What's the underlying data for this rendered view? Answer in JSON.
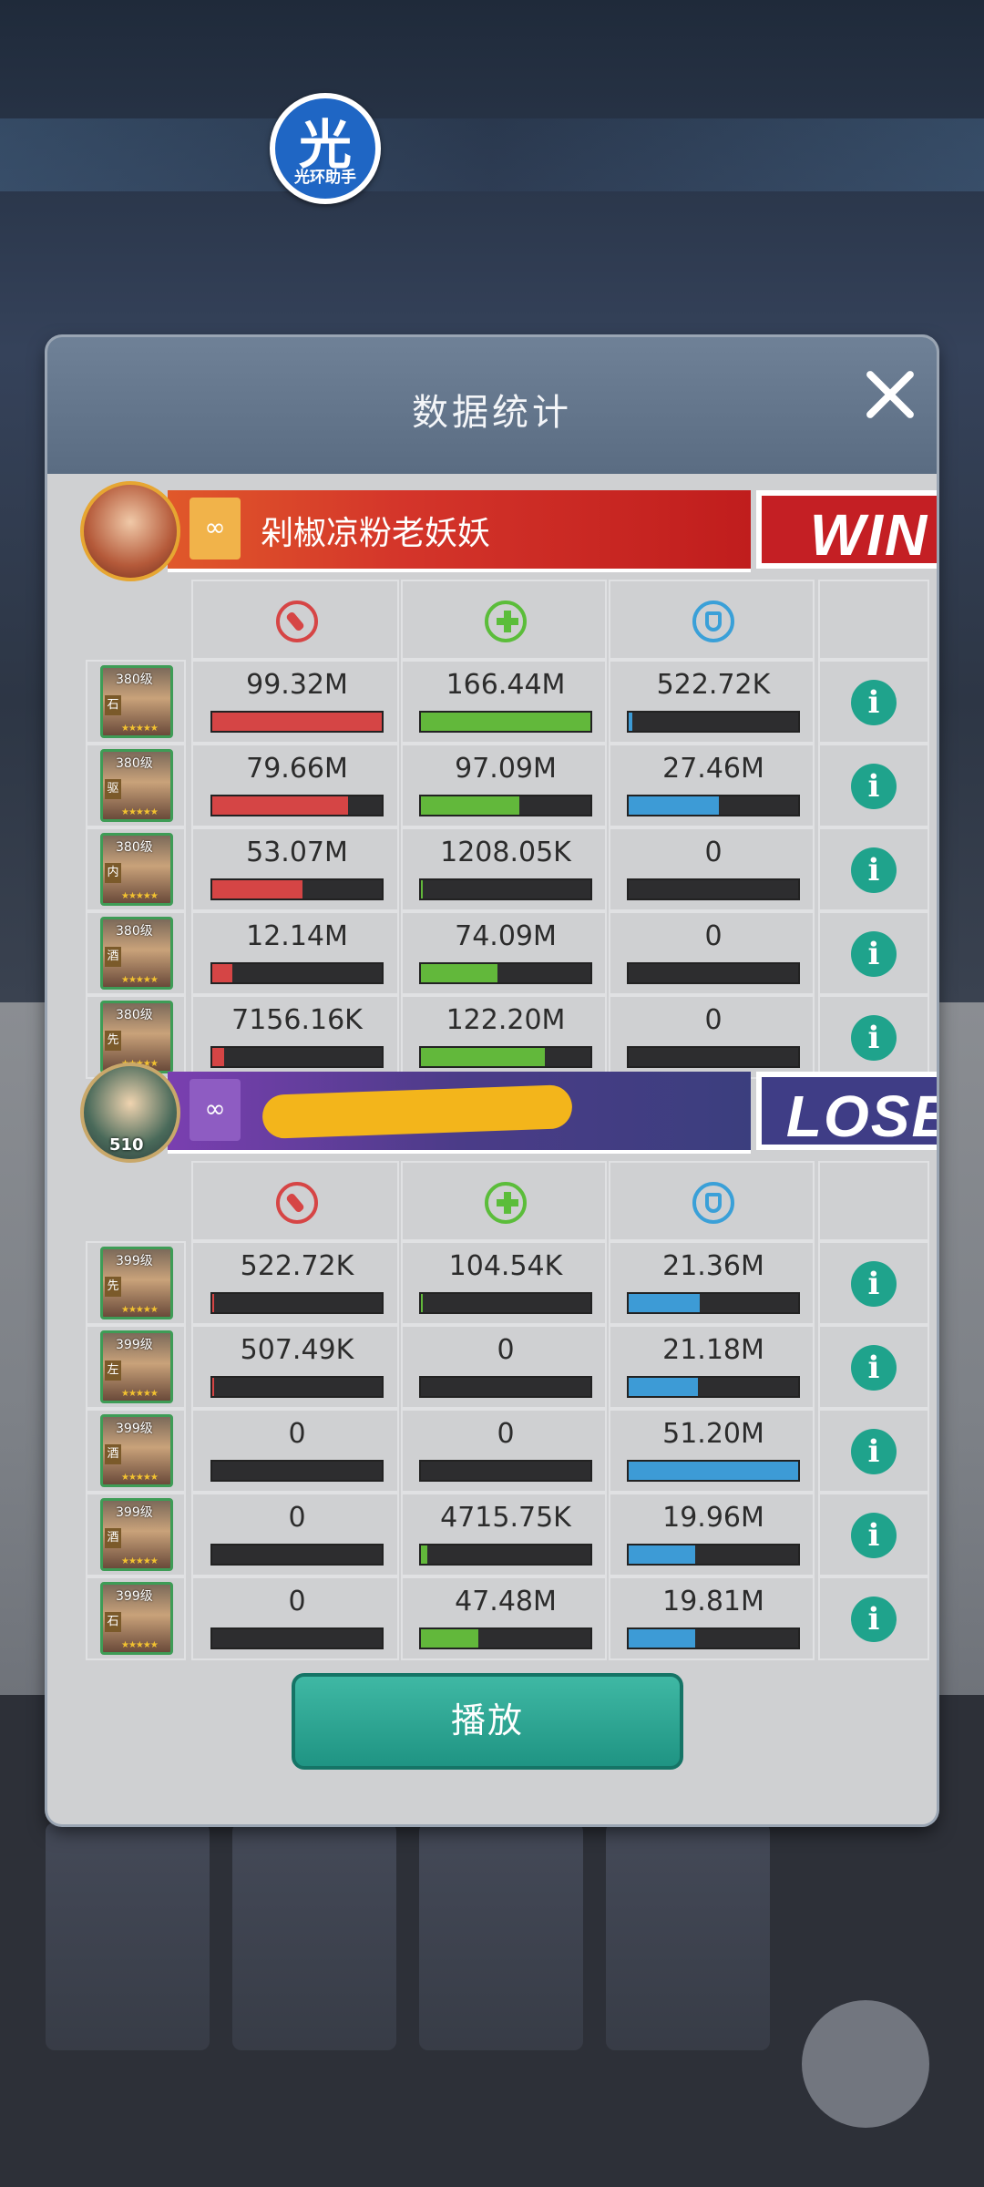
{
  "watermark": {
    "char": "光",
    "text": "光环助手"
  },
  "dialog": {
    "title": "数据统计",
    "play_label": "播放"
  },
  "teams": [
    {
      "name": "剁椒凉粉老妖妖",
      "result": "WIN",
      "avatar_level": "",
      "rows": [
        {
          "level": "380级",
          "tag": "石",
          "damage": "99.32M",
          "heal": "166.44M",
          "tank": "522.72K",
          "damage_pct": 100,
          "heal_pct": 100,
          "tank_pct": 2
        },
        {
          "level": "380级",
          "tag": "驱",
          "damage": "79.66M",
          "heal": "97.09M",
          "tank": "27.46M",
          "damage_pct": 80,
          "heal_pct": 58,
          "tank_pct": 53
        },
        {
          "level": "380级",
          "tag": "内",
          "damage": "53.07M",
          "heal": "1208.05K",
          "tank": "0",
          "damage_pct": 53,
          "heal_pct": 1,
          "tank_pct": 0
        },
        {
          "level": "380级",
          "tag": "酒",
          "damage": "12.14M",
          "heal": "74.09M",
          "tank": "0",
          "damage_pct": 12,
          "heal_pct": 45,
          "tank_pct": 0
        },
        {
          "level": "380级",
          "tag": "先",
          "damage": "7156.16K",
          "heal": "122.20M",
          "tank": "0",
          "damage_pct": 7,
          "heal_pct": 73,
          "tank_pct": 0
        }
      ]
    },
    {
      "name": "",
      "result": "LOSE",
      "avatar_level": "510",
      "rows": [
        {
          "level": "399级",
          "tag": "先",
          "damage": "522.72K",
          "heal": "104.54K",
          "tank": "21.36M",
          "damage_pct": 1,
          "heal_pct": 1,
          "tank_pct": 42
        },
        {
          "level": "399级",
          "tag": "左",
          "damage": "507.49K",
          "heal": "0",
          "tank": "21.18M",
          "damage_pct": 1,
          "heal_pct": 0,
          "tank_pct": 41
        },
        {
          "level": "399级",
          "tag": "酒",
          "damage": "0",
          "heal": "0",
          "tank": "51.20M",
          "damage_pct": 0,
          "heal_pct": 0,
          "tank_pct": 100
        },
        {
          "level": "399级",
          "tag": "酒",
          "damage": "0",
          "heal": "4715.75K",
          "tank": "19.96M",
          "damage_pct": 0,
          "heal_pct": 4,
          "tank_pct": 39
        },
        {
          "level": "399级",
          "tag": "石",
          "damage": "0",
          "heal": "47.48M",
          "tank": "19.81M",
          "damage_pct": 0,
          "heal_pct": 34,
          "tank_pct": 39
        }
      ]
    }
  ],
  "colors": {
    "damage": "#d54545",
    "heal": "#62b83b",
    "tank": "#3d9bd6",
    "win": "#c41f24",
    "lose": "#3f3d86"
  },
  "icons": {
    "damage": "sword-icon",
    "heal": "plus-icon",
    "tank": "shield-icon",
    "info": "info-icon",
    "close": "close-icon"
  }
}
